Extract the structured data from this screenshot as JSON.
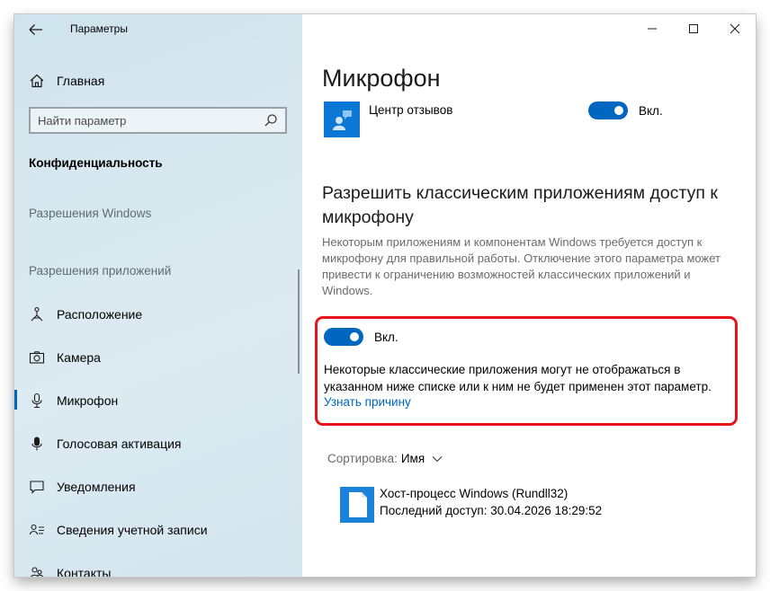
{
  "window": {
    "title": "Параметры"
  },
  "sidebar": {
    "home_label": "Главная",
    "search_placeholder": "Найти параметр",
    "section_title": "Конфиденциальность",
    "group_windows": "Разрешения Windows",
    "group_apps": "Разрешения приложений",
    "items": [
      {
        "label": "Расположение",
        "icon": "location-icon"
      },
      {
        "label": "Камера",
        "icon": "camera-icon"
      },
      {
        "label": "Микрофон",
        "icon": "microphone-icon",
        "active": true
      },
      {
        "label": "Голосовая активация",
        "icon": "voice-activation-icon"
      },
      {
        "label": "Уведомления",
        "icon": "notifications-icon"
      },
      {
        "label": "Сведения учетной записи",
        "icon": "account-info-icon"
      },
      {
        "label": "Контакты",
        "icon": "contacts-icon"
      }
    ]
  },
  "main": {
    "page_title": "Микрофон",
    "feedback_app": {
      "name": "Центр отзывов",
      "toggle_label": "Вкл."
    },
    "classic_heading": "Разрешить классическим приложениям доступ к микрофону",
    "classic_description": "Некоторым приложениям и компонентам Windows требуется доступ к микрофону для правильной работы. Отключение этого параметра может привести к ограничению возможностей классических приложений и Windows.",
    "classic_toggle_label": "Вкл.",
    "classic_note": "Некоторые классические приложения могут не отображаться в указанном ниже списке или к ним не будет применен этот параметр.",
    "learn_why": "Узнать причину",
    "sort_label": "Сортировка:",
    "sort_value": "Имя",
    "app": {
      "name": "Хост-процесс Windows (Rundll32)",
      "last_access": "Последний доступ: 30.04.2026 18:29:52"
    }
  },
  "colors": {
    "accent": "#0067c0",
    "highlight_border": "#e8141b"
  }
}
